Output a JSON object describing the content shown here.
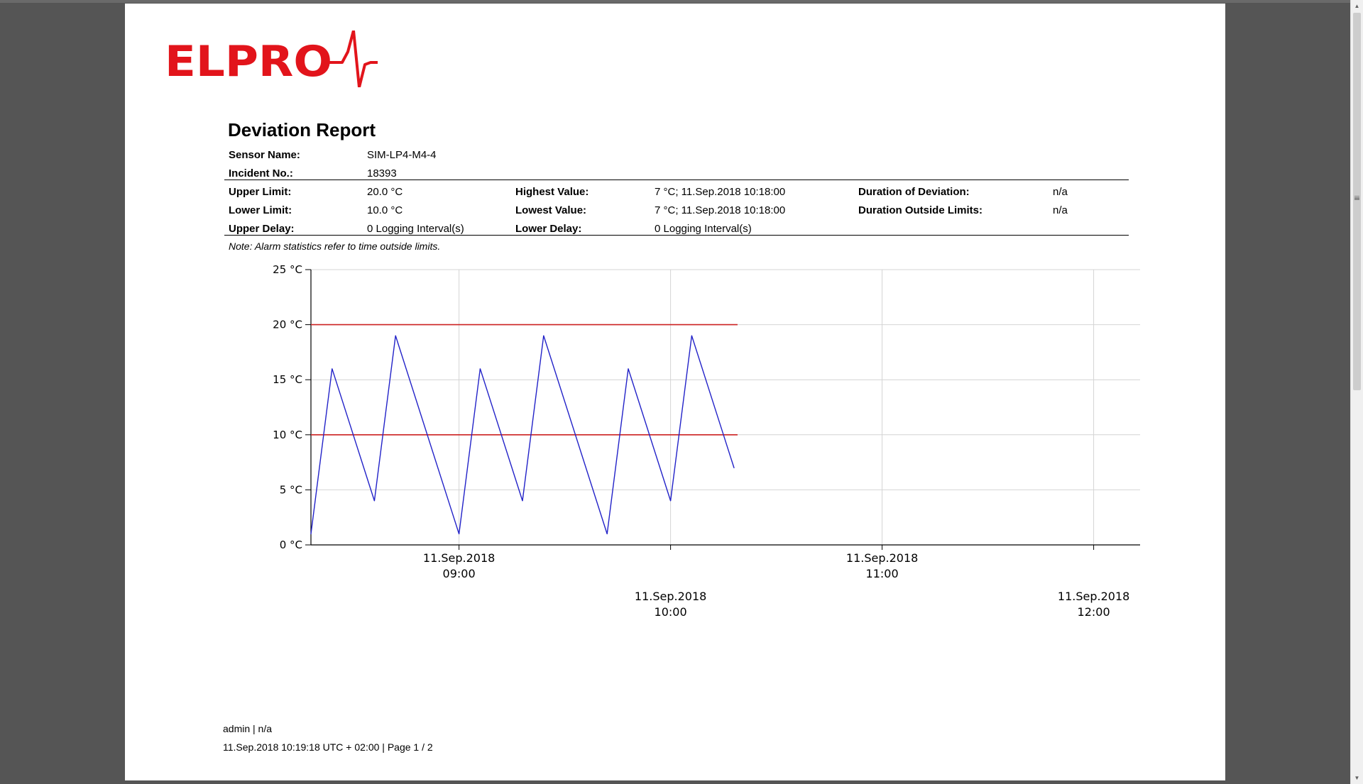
{
  "brand": {
    "logo_text": "ELPRO",
    "logo_color": "#e2141b"
  },
  "report": {
    "title": "Deviation Report",
    "sensor_name_label": "Sensor Name:",
    "sensor_name": "SIM-LP4-M4-4",
    "incident_label": "Incident No.:",
    "incident_no": "18393",
    "upper_limit_label": "Upper Limit:",
    "upper_limit": "20.0 °C",
    "lower_limit_label": "Lower Limit:",
    "lower_limit": "10.0 °C",
    "upper_delay_label": "Upper Delay:",
    "upper_delay": "0 Logging Interval(s)",
    "highest_value_label": "Highest Value:",
    "highest_value": "7 °C; 11.Sep.2018 10:18:00",
    "lowest_value_label": "Lowest Value:",
    "lowest_value": "7 °C; 11.Sep.2018 10:18:00",
    "lower_delay_label": "Lower Delay:",
    "lower_delay": "0 Logging Interval(s)",
    "duration_deviation_label": "Duration of Deviation:",
    "duration_deviation": "n/a",
    "duration_outside_label": "Duration Outside Limits:",
    "duration_outside": "n/a",
    "note": "Note: Alarm statistics refer to time outside limits."
  },
  "chart_data": {
    "type": "line",
    "x_unit": "minutes",
    "x_range": [
      "2018-09-11 08:18",
      "2018-09-11 12:18"
    ],
    "ylim": [
      0,
      25
    ],
    "y_ticks": [
      {
        "value": 0,
        "label": "0 °C"
      },
      {
        "value": 5,
        "label": "5 °C"
      },
      {
        "value": 10,
        "label": "10 °C"
      },
      {
        "value": 15,
        "label": "15 °C"
      },
      {
        "value": 20,
        "label": "20 °C"
      },
      {
        "value": 25,
        "label": "25 °C"
      }
    ],
    "x_ticks": [
      {
        "time": "2018-09-11 09:00",
        "date": "11.Sep.2018",
        "hour": "09:00",
        "row": 1
      },
      {
        "time": "2018-09-11 10:00",
        "date": "11.Sep.2018",
        "hour": "10:00",
        "row": 2
      },
      {
        "time": "2018-09-11 11:00",
        "date": "11.Sep.2018",
        "hour": "11:00",
        "row": 1
      },
      {
        "time": "2018-09-11 12:00",
        "date": "11.Sep.2018",
        "hour": "12:00",
        "row": 2
      }
    ],
    "series": [
      {
        "color": "#2222c8",
        "points": [
          [
            "2018-09-11 08:18",
            1
          ],
          [
            "2018-09-11 08:24",
            16
          ],
          [
            "2018-09-11 08:36",
            4
          ],
          [
            "2018-09-11 08:42",
            19
          ],
          [
            "2018-09-11 09:00",
            1
          ],
          [
            "2018-09-11 09:06",
            16
          ],
          [
            "2018-09-11 09:18",
            4
          ],
          [
            "2018-09-11 09:24",
            19
          ],
          [
            "2018-09-11 09:42",
            1
          ],
          [
            "2018-09-11 09:48",
            16
          ],
          [
            "2018-09-11 10:00",
            4
          ],
          [
            "2018-09-11 10:06",
            19
          ],
          [
            "2018-09-11 10:18",
            7
          ]
        ]
      }
    ],
    "limits": [
      {
        "value": 20,
        "color": "#cc2222",
        "from": "2018-09-11 08:18",
        "to": "2018-09-11 10:19"
      },
      {
        "value": 10,
        "color": "#cc2222",
        "from": "2018-09-11 08:18",
        "to": "2018-09-11 10:19"
      }
    ],
    "grid": true
  },
  "footer": {
    "user": "admin | n/a",
    "printed": "11.Sep.2018 10:19:18 UTC + 02:00 | Page 1 / 2"
  }
}
